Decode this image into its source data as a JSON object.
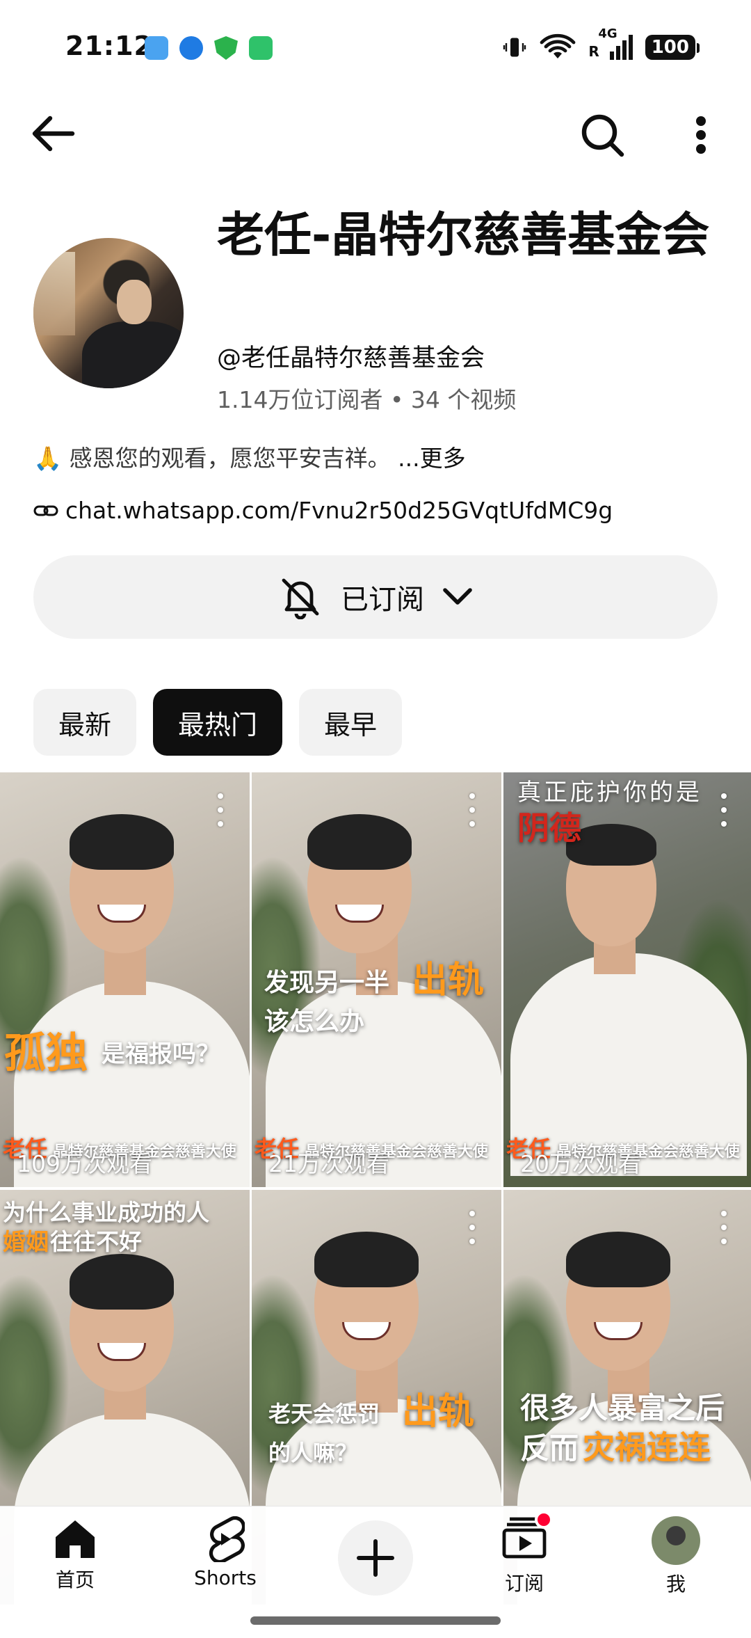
{
  "status_bar": {
    "time": "21:12",
    "battery": "100",
    "network": "4G",
    "roaming": "R",
    "app_icons": [
      "weather-app-icon",
      "browser-app-icon",
      "security-app-icon",
      "battery-app-icon"
    ],
    "app_colors": [
      "#4aa3f0",
      "#1f7be3",
      "#2bb24c",
      "#2fc26a"
    ]
  },
  "appbar": {
    "back_icon": "arrow-left-icon",
    "search_icon": "search-icon",
    "more_icon": "more-vertical-icon"
  },
  "channel": {
    "title": "老任-晶特尔慈善基金会",
    "handle": "@老任晶特尔慈善基金会",
    "stats": "1.14万位订阅者 • 34 个视频",
    "description": "🙏 感恩您的观看，愿您平安吉祥。",
    "description_more": "...更多",
    "link": "chat.whatsapp.com/Fvnu2r50d25GVqtUfdMC9g",
    "subscribe_label": "已订阅"
  },
  "chips": [
    {
      "label": "最新",
      "active": false
    },
    {
      "label": "最热门",
      "active": true
    },
    {
      "label": "最早",
      "active": false
    }
  ],
  "videos": [
    {
      "overlay_a": "孤独",
      "overlay_b": "是福报吗？",
      "caption_name": "老任",
      "caption": "晶特尔慈善基金会慈善大使",
      "views": "109万次观看"
    },
    {
      "overlay_a": "发现另一半",
      "overlay_b": "出轨",
      "overlay_c": "该怎么办",
      "caption_name": "老任",
      "caption": "晶特尔慈善基金会慈善大使",
      "views": "21万次观看"
    },
    {
      "overlay_a": "真正庇护你的是",
      "overlay_b": "阴德",
      "caption_name": "老任",
      "caption": "晶特尔慈善基金会慈善大使",
      "views": "20万次观看"
    },
    {
      "overlay_a": "为什么事业成功的人",
      "overlay_b": "婚姻",
      "overlay_c": "往往不好"
    },
    {
      "overlay_a": "老天会惩罚",
      "overlay_b": "出轨",
      "overlay_c": "的人嘛？"
    },
    {
      "overlay_a": "很多人暴富之后",
      "overlay_b": "反而",
      "overlay_c": "灾祸连连"
    }
  ],
  "bottom_nav": {
    "home": "首页",
    "shorts": "Shorts",
    "subscriptions": "订阅",
    "me": "我"
  }
}
